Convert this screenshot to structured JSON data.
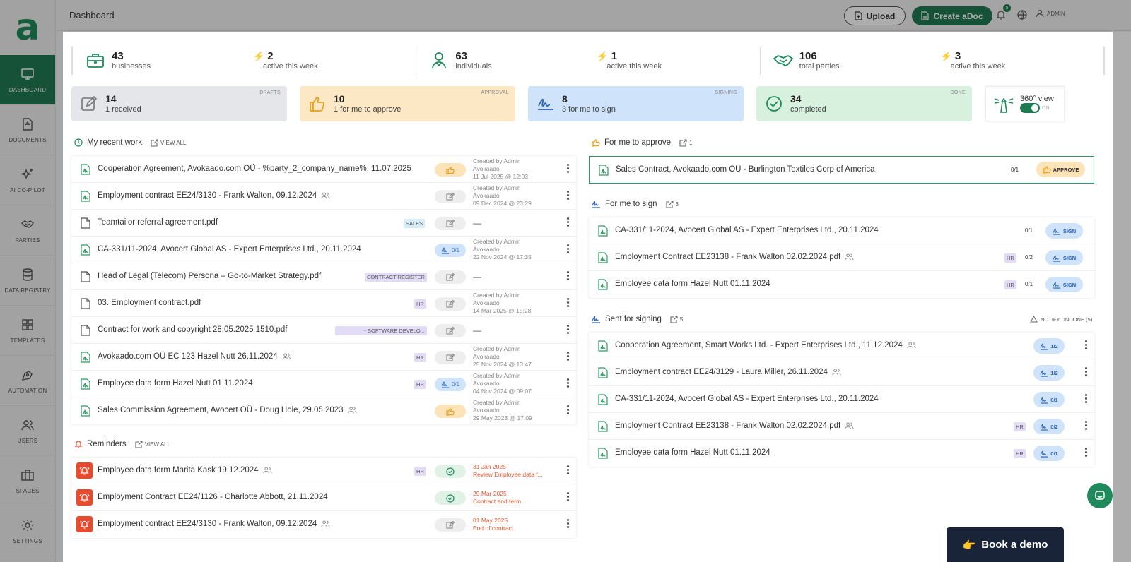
{
  "topbar": {
    "title": "Dashboard",
    "upload": "Upload",
    "create": "Create aDoc",
    "notif_count": "5",
    "user": "ADMIN"
  },
  "sidebar": {
    "items": [
      {
        "label": "DASHBOARD",
        "icon": "monitor-icon"
      },
      {
        "label": "DOCUMENTS",
        "icon": "document-icon"
      },
      {
        "label": "AI CO-PILOT",
        "icon": "sparkle-icon"
      },
      {
        "label": "PARTIES",
        "icon": "handshake-icon"
      },
      {
        "label": "DATA REGISTRY",
        "icon": "database-icon"
      },
      {
        "label": "TEMPLATES",
        "icon": "grid-icon"
      },
      {
        "label": "AUTOMATION",
        "icon": "pen-tool-icon"
      },
      {
        "label": "USERS",
        "icon": "users-icon"
      },
      {
        "label": "SPACES",
        "icon": "briefcase-icon"
      },
      {
        "label": "SETTINGS",
        "icon": "gear-icon"
      }
    ]
  },
  "stats": [
    {
      "num": "43",
      "label": "businesses",
      "active_num": "2",
      "active_label": "active this week"
    },
    {
      "num": "63",
      "label": "individuals",
      "active_num": "1",
      "active_label": "active this week"
    },
    {
      "num": "106",
      "label": "total parties",
      "active_num": "3",
      "active_label": "active this week"
    }
  ],
  "cards": [
    {
      "num": "14",
      "sub": "1 received",
      "tag": "DRAFTS"
    },
    {
      "num": "10",
      "sub": "1 for me to approve",
      "tag": "APPROVAL"
    },
    {
      "num": "8",
      "sub": "3 for me to sign",
      "tag": "SIGNING"
    },
    {
      "num": "34",
      "sub": "completed",
      "tag": "DONE"
    }
  ],
  "view360": {
    "label": "360° view",
    "state": "ON"
  },
  "recent": {
    "title": "My recent work",
    "link": "VIEW ALL",
    "rows": [
      {
        "title": "Cooperation Agreement, Avokaado.com OÜ - %party_2_company_name%, 11.07.2025",
        "meta1": "Created by Admin",
        "meta2": "Avokaado",
        "meta3": "11 Jul 2025 @ 12:03"
      },
      {
        "title": "Employment contract EE24/3130 - Frank Walton, 09.12.2024",
        "meta1": "Created by Admin",
        "meta2": "Avokaado",
        "meta3": "09 Dec 2024 @ 23:29"
      },
      {
        "title": "Teamtailor referral agreement.pdf",
        "tag": "SALES",
        "dash": "—"
      },
      {
        "title": "CA-331/11-2024, Avocert Global AS - Expert Enterprises Ltd., 20.11.2024",
        "pill": "0/1",
        "meta1": "Created by Admin",
        "meta2": "Avokaado",
        "meta3": "22 Nov 2024 @ 17:35"
      },
      {
        "title": "Head of Legal (Telecom) Persona – Go-to-Market Strategy.pdf",
        "tag": "CONTRACT REGISTER",
        "dash": "—"
      },
      {
        "title": "03. Employment contract.pdf",
        "tag": "HR",
        "meta1": "Created by Admin",
        "meta2": "Avokaado",
        "meta3": "14 Mar 2025 @ 15:28"
      },
      {
        "title": "Contract for work and copyright 28.05.2025 1510.pdf",
        "tag": "- SOFTWARE DEVELO...",
        "dash": "—"
      },
      {
        "title": "Avokaado.com OÜ EC 123 Hazel Nutt 26.11.2024",
        "tag": "HR",
        "meta1": "Created by Admin",
        "meta2": "Avokaado",
        "meta3": "25 Nov 2024 @ 13:47"
      },
      {
        "title": "Employee data form Hazel Nutt 01.11.2024",
        "tag": "HR",
        "pill": "0/1",
        "meta1": "Created by Admin",
        "meta2": "Avokaado",
        "meta3": "04 Nov 2024 @ 09:07"
      },
      {
        "title": "Sales Commission Agreement, Avocert OÜ - Doug Hole, 29.05.2023",
        "meta1": "Created by Admin",
        "meta2": "Avokaado",
        "meta3": "29 May 2023 @ 17:09"
      }
    ]
  },
  "reminders": {
    "title": "Reminders",
    "link": "VIEW ALL",
    "rows": [
      {
        "title": "Employee data form Marita Kask 19.12.2024",
        "tag": "HR",
        "date": "31 Jan 2025",
        "note": "Review Employee data f..."
      },
      {
        "title": "Employment Contract EE24/1126 - Charlotte Abbott, 21.11.2024",
        "date": "29 Mar 2025",
        "note": "Contract end term"
      },
      {
        "title": "Employment contract EE24/3130 - Frank Walton, 09.12.2024",
        "date": "01 May 2025",
        "note": "End of contract"
      }
    ]
  },
  "approve": {
    "title": "For me to approve",
    "count": "1",
    "rows": [
      {
        "title": "Sales Contract, Avokaado.com OÜ - Burlington Textiles Corp of America",
        "count": "0/1",
        "btn": "APPROVE"
      }
    ]
  },
  "sign": {
    "title": "For me to sign",
    "count": "3",
    "rows": [
      {
        "title": "CA-331/11-2024, Avocert Global AS - Expert Enterprises Ltd., 20.11.2024",
        "count": "0/1",
        "btn": "SIGN"
      },
      {
        "title": "Employment Contract EE23138 - Frank Walton 02.02.2024.pdf",
        "tag": "HR",
        "count": "0/2",
        "btn": "SIGN"
      },
      {
        "title": "Employee data form Hazel Nutt 01.11.2024",
        "tag": "HR",
        "count": "0/1",
        "btn": "SIGN"
      }
    ]
  },
  "sent": {
    "title": "Sent for signing",
    "count": "5",
    "notify": "NOTIFY UNDONE (5)",
    "rows": [
      {
        "title": "Cooperation Agreement, Smart Works Ltd. - Expert Enterprises Ltd., 11.12.2024",
        "pill": "1/2"
      },
      {
        "title": "Employment contract EE24/3129 - Laura Miller, 26.11.2024",
        "pill": "1/2"
      },
      {
        "title": "CA-331/11-2024, Avocert Global AS - Expert Enterprises Ltd., 20.11.2024",
        "pill": "0/1"
      },
      {
        "title": "Employment Contract EE23138 - Frank Walton 02.02.2024.pdf",
        "tag": "HR",
        "pill": "0/2"
      },
      {
        "title": "Employee data form Hazel Nutt 01.11.2024",
        "tag": "HR",
        "pill": "0/1"
      }
    ]
  },
  "demo": {
    "label": "Book a demo",
    "emoji": "👉"
  },
  "colors": {
    "brand": "#1f7a52",
    "approve": "#fce3b8",
    "sign": "#cfe3fb",
    "done": "#d7f1de",
    "drafts": "#e4e6ea"
  }
}
